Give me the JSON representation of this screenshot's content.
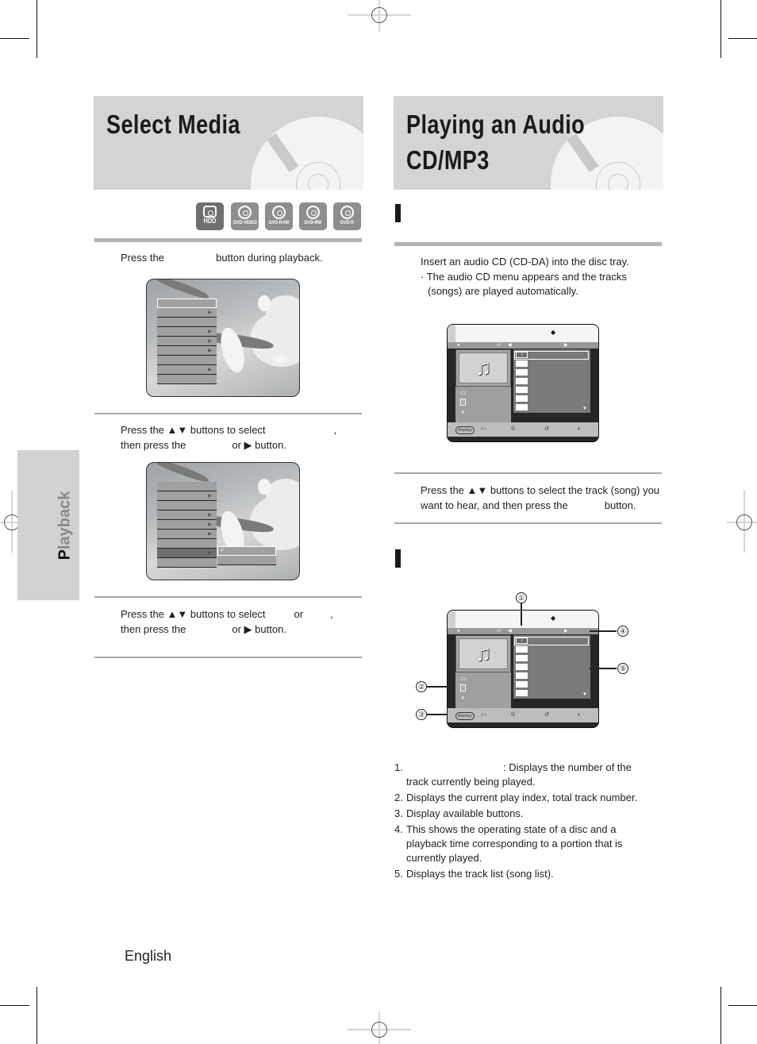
{
  "left_section": {
    "title": "Select Media",
    "media_icons": [
      {
        "icon": "hdd-icon",
        "label": "HDD"
      },
      {
        "icon": "dvd-video-icon",
        "label": "DVD-VIDEO"
      },
      {
        "icon": "dvd-ram-icon",
        "label": "DVD-RAM"
      },
      {
        "icon": "dvd-rw-icon",
        "label": "DVD-RW"
      },
      {
        "icon": "dvd-r-icon",
        "label": "DVD-R"
      }
    ],
    "steps": [
      {
        "line1": "Press the",
        "line1b": "button during playback."
      },
      {
        "line1": "Press the ▲▼ buttons to select",
        "line1b": ",",
        "line2": "then press the",
        "line2b": "or ▶ button."
      },
      {
        "line1": "Press the ▲▼ buttons to select",
        "line1_or": "or",
        "line1b": ",",
        "line2": "then press the",
        "line2b": "or ▶ button."
      }
    ],
    "menu_screen_1": {
      "rows": 9,
      "arrow_rows": [
        1,
        3,
        4,
        5,
        7
      ],
      "selected_row": 0
    },
    "menu_screen_2": {
      "rows": 9,
      "arrow_rows": [
        1,
        3,
        4,
        5,
        7
      ],
      "highlight_row": 7,
      "submenu_check": "✓"
    }
  },
  "side_tab": {
    "first_letter": "P",
    "rest": "layback"
  },
  "footer": {
    "language": "English"
  },
  "right_section": {
    "title_line1": "Playing an Audio",
    "title_line2": "CD/MP3",
    "step1": {
      "line1": "Insert an audio CD (CD-DA) into the disc tray.",
      "bullet": "· The audio CD menu appears and the tracks",
      "bullet_cont": "(songs) are played automatically."
    },
    "step2": {
      "line1": "Press the ▲▼ buttons to select the track (song) you",
      "line2": "want to hear, and then press the",
      "line2b": "button."
    },
    "osd": {
      "status_time": "‹/›",
      "play_symbol": "▶",
      "note_symbol": "♫",
      "track_rows": 7,
      "anykey_label": "Anykey",
      "bottom_icons": [
        "‹·›",
        "©",
        "↺",
        "◐"
      ]
    },
    "callouts": [
      "①",
      "②",
      "③",
      "④",
      "⑤"
    ],
    "descriptions": [
      {
        "num": "1.",
        "text": ": Displays the number of the",
        "cont": "track currently being played."
      },
      {
        "num": "2.",
        "text": "Displays the current play index, total track number."
      },
      {
        "num": "3.",
        "text": "Display available buttons."
      },
      {
        "num": "4.",
        "text": "This shows the operating state of a disc and a",
        "cont": "playback time corresponding to a portion that is",
        "cont2": "currently played."
      },
      {
        "num": "5.",
        "text": "Displays the track list (song list)."
      }
    ]
  }
}
